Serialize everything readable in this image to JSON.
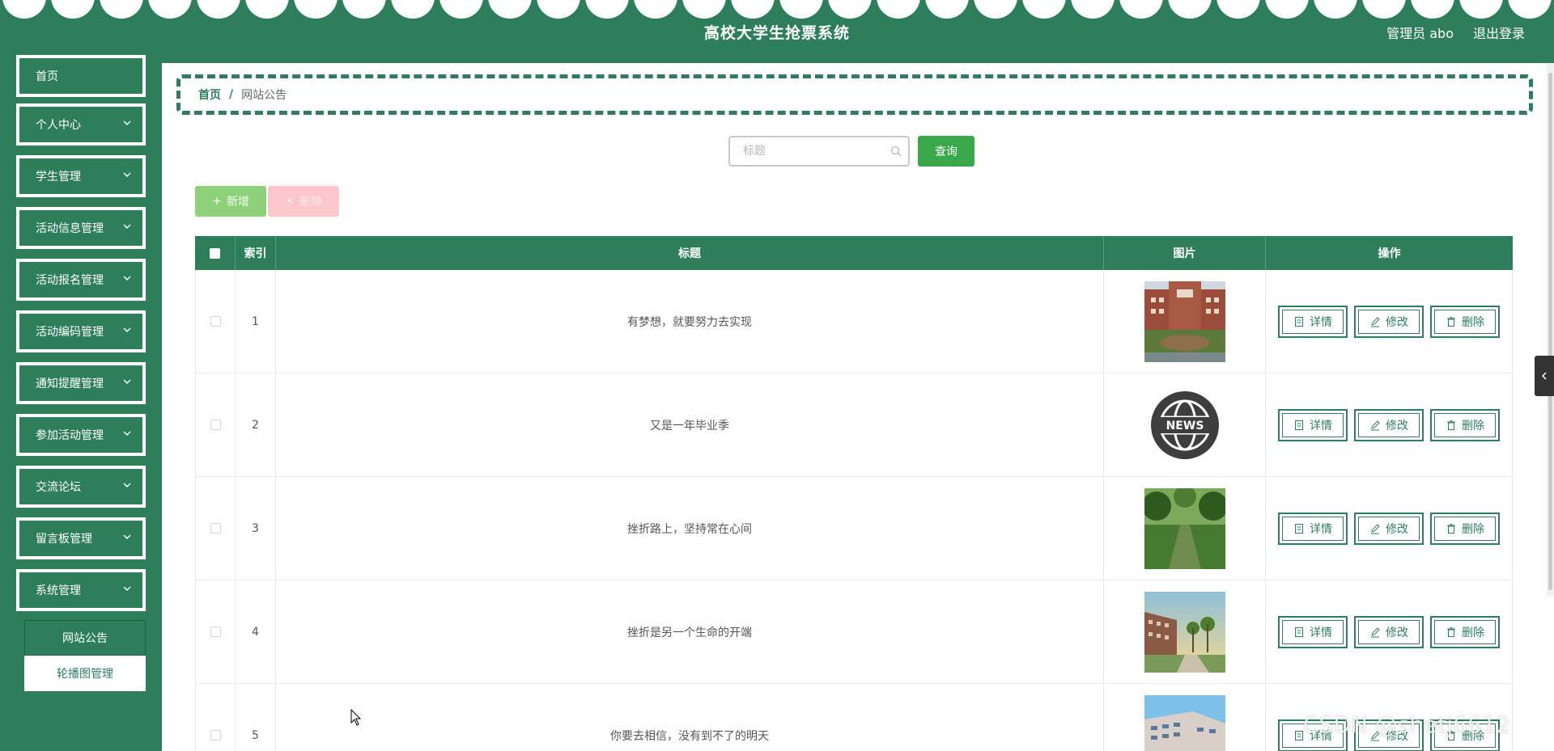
{
  "header": {
    "title": "高校大学生抢票系统",
    "user_label": "管理员 abo",
    "logout_label": "退出登录"
  },
  "sidebar": {
    "items": [
      {
        "label": "首页",
        "has_arrow": false
      },
      {
        "label": "个人中心",
        "has_arrow": true
      },
      {
        "label": "学生管理",
        "has_arrow": true
      },
      {
        "label": "活动信息管理",
        "has_arrow": true
      },
      {
        "label": "活动报名管理",
        "has_arrow": true
      },
      {
        "label": "活动编码管理",
        "has_arrow": true
      },
      {
        "label": "通知提醒管理",
        "has_arrow": true
      },
      {
        "label": "参加活动管理",
        "has_arrow": true
      },
      {
        "label": "交流论坛",
        "has_arrow": true
      },
      {
        "label": "留言板管理",
        "has_arrow": true
      },
      {
        "label": "系统管理",
        "has_arrow": true
      }
    ],
    "submenu": [
      {
        "label": "网站公告",
        "active": true
      },
      {
        "label": "轮播图管理",
        "active": false
      }
    ]
  },
  "breadcrumb": {
    "home": "首页",
    "separator": "/",
    "current": "网站公告"
  },
  "search": {
    "placeholder": "标题",
    "value": "",
    "button_label": "查询"
  },
  "toolbar": {
    "add_label": "新增",
    "delete_label": "删除"
  },
  "table": {
    "columns": [
      "索引",
      "标题",
      "图片",
      "操作"
    ],
    "rows": [
      {
        "index": "1",
        "title": "有梦想，就要努力去实现",
        "image": "campus-building"
      },
      {
        "index": "2",
        "title": "又是一年毕业季",
        "image": "news-globe"
      },
      {
        "index": "3",
        "title": "挫折路上，坚持常在心间",
        "image": "tree-avenue"
      },
      {
        "index": "4",
        "title": "挫折是另一个生命的开端",
        "image": "sunset-campus"
      },
      {
        "index": "5",
        "title": "你要去相信，没有到不了的明天",
        "image": "school-building"
      }
    ],
    "actions": {
      "detail": "详情",
      "edit": "修改",
      "delete": "删除"
    }
  },
  "watermark": "CSDN @shetj6612",
  "colors": {
    "primary": "#2e7d5b",
    "query_button": "#3aa84a",
    "add_button": "#8fd07a",
    "delete_button": "#fbc7cc"
  }
}
